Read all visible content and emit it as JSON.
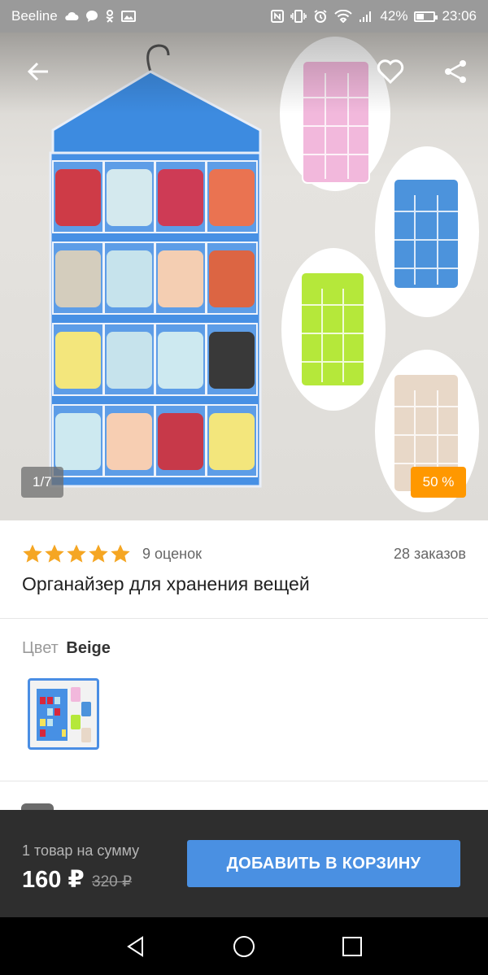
{
  "status_bar": {
    "carrier": "Beeline",
    "battery": "42%",
    "battery_level": 0.42,
    "time": "23:06"
  },
  "product": {
    "slide_counter": "1/7",
    "discount": "50 %",
    "rating": 5,
    "reviews": "9 оценок",
    "orders": "28 заказов",
    "title": "Органайзер для хранения вещей"
  },
  "color": {
    "label": "Цвет",
    "value": "Beige"
  },
  "cart": {
    "sum_label": "1 товар на сумму",
    "price": "160 ₽",
    "old_price": "320 ₽",
    "add_button": "ДОБАВИТЬ В КОРЗИНУ"
  },
  "colors": {
    "accent": "#4a90e2",
    "badge": "#ff9800",
    "star": "#f5a623",
    "bar": "#2e2e2e"
  },
  "icons": [
    "back-arrow-icon",
    "heart-icon",
    "share-icon",
    "nav-back-icon",
    "nav-home-icon",
    "nav-recents-icon"
  ]
}
